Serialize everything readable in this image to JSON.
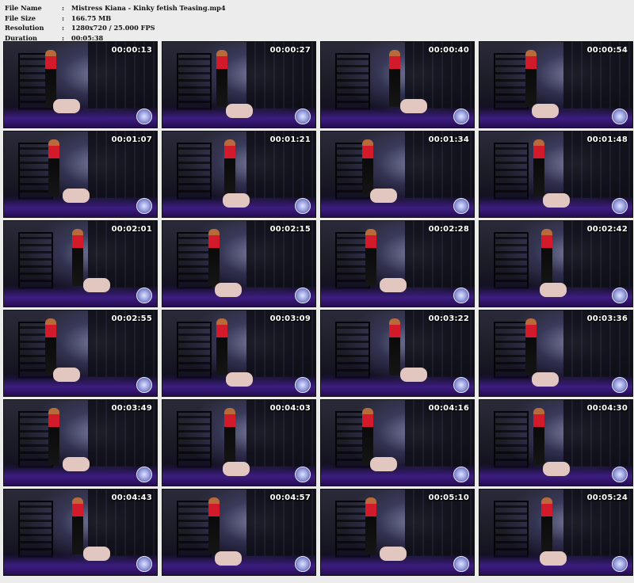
{
  "header": {
    "file_name_label": "File Name",
    "file_name": "Mistress Kiana - Kinky fetish Teasing.mp4",
    "file_size_label": "File Size",
    "file_size": "166.75 MB",
    "resolution_label": "Resolution",
    "resolution": "1280x720 / 25.000 FPS",
    "duration_label": "Duration",
    "duration": "00:05:38",
    "separator": ":"
  },
  "thumbnails": [
    {
      "time": "00:00:13"
    },
    {
      "time": "00:00:27"
    },
    {
      "time": "00:00:40"
    },
    {
      "time": "00:00:54"
    },
    {
      "time": "00:01:07"
    },
    {
      "time": "00:01:21"
    },
    {
      "time": "00:01:34"
    },
    {
      "time": "00:01:48"
    },
    {
      "time": "00:02:01"
    },
    {
      "time": "00:02:15"
    },
    {
      "time": "00:02:28"
    },
    {
      "time": "00:02:42"
    },
    {
      "time": "00:02:55"
    },
    {
      "time": "00:03:09"
    },
    {
      "time": "00:03:22"
    },
    {
      "time": "00:03:36"
    },
    {
      "time": "00:03:49"
    },
    {
      "time": "00:04:03"
    },
    {
      "time": "00:04:16"
    },
    {
      "time": "00:04:30"
    },
    {
      "time": "00:04:43"
    },
    {
      "time": "00:04:57"
    },
    {
      "time": "00:05:10"
    },
    {
      "time": "00:05:24"
    }
  ]
}
